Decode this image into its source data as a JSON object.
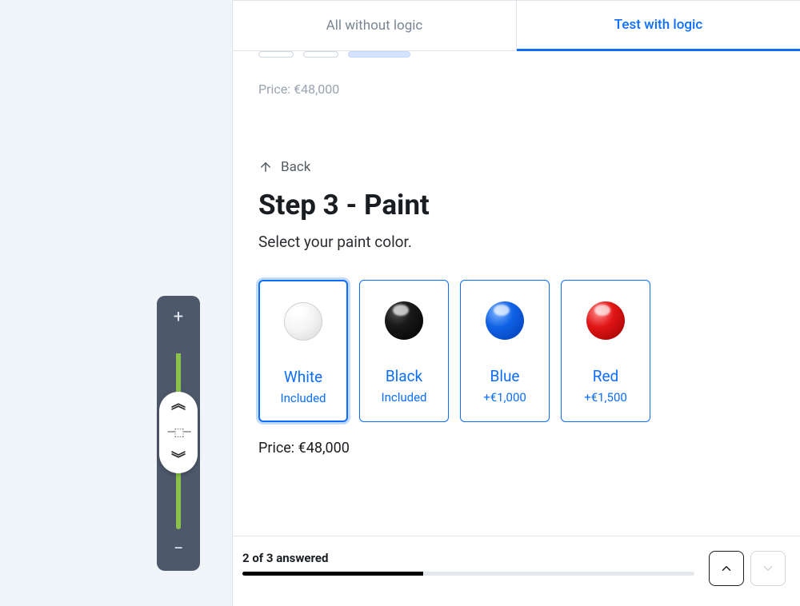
{
  "tabs": {
    "inactive": "All without logic",
    "active": "Test with logic"
  },
  "prev_price": "Price: €48,000",
  "back_label": "Back",
  "step_title": "Step 3 - Paint",
  "subtitle": "Select your paint color.",
  "options": [
    {
      "name": "White",
      "cost": "Included",
      "swatch": "white",
      "selected": true
    },
    {
      "name": "Black",
      "cost": "Included",
      "swatch": "black",
      "selected": false
    },
    {
      "name": "Blue",
      "cost": "+€1,000",
      "swatch": "blue",
      "selected": false
    },
    {
      "name": "Red",
      "cost": "+€1,500",
      "swatch": "red",
      "selected": false
    }
  ],
  "price_line": "Price: €48,000",
  "progress": {
    "label": "2 of 3 answered",
    "percent": 40
  },
  "icons": {
    "plus": "+",
    "minus": "−"
  }
}
